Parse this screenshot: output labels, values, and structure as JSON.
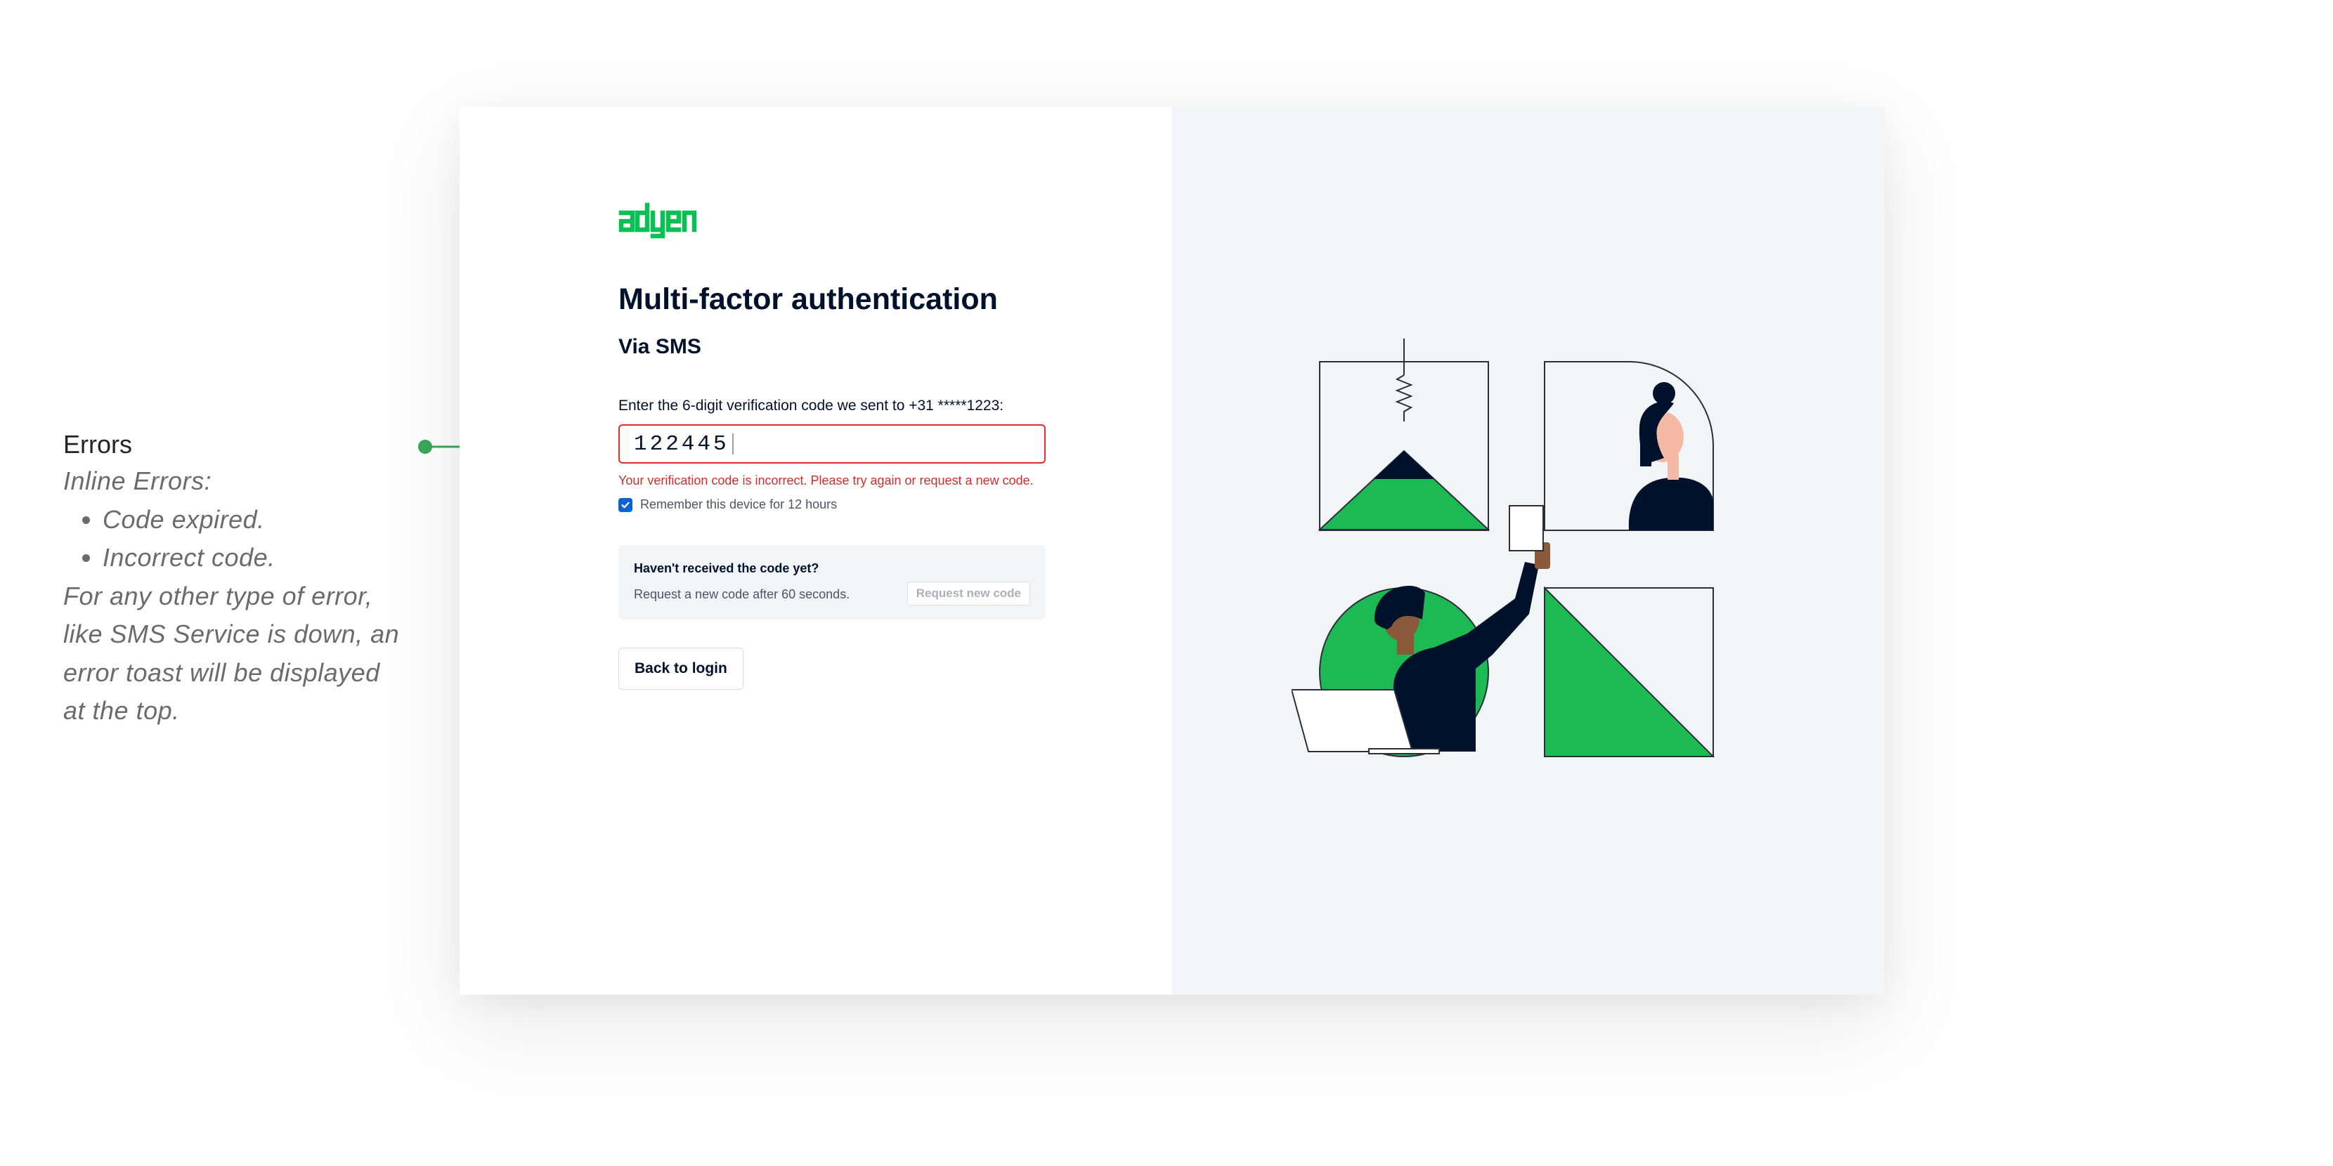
{
  "annotation": {
    "title": "Errors",
    "intro": "Inline Errors:",
    "bullets": [
      "Code expired.",
      "Incorrect code."
    ],
    "footer_lines": [
      "For any other type of error,",
      "like SMS Service is down, an",
      "error toast will be displayed",
      "at the top."
    ]
  },
  "brand": {
    "logo_text": "adyen",
    "accent": "#0abf53"
  },
  "mfa": {
    "title": "Multi-factor authentication",
    "subtitle": "Via SMS",
    "code_label": "Enter the 6-digit verification code we sent to +31 *****1223:",
    "code_value": "122445",
    "error_message": "Your verification code is incorrect. Please try again or request a new code.",
    "remember_label": "Remember this device for 12 hours",
    "remember_checked": true,
    "resend": {
      "title": "Haven't received the code yet?",
      "text": "Request a new code after 60 seconds.",
      "button_label": "Request new code"
    },
    "back_label": "Back to login"
  },
  "colors": {
    "error": "#e22d2d",
    "checkbox": "#0a63d6",
    "illustration_green": "#1db954",
    "navy": "#00112c",
    "connector": "#3aa75a"
  }
}
